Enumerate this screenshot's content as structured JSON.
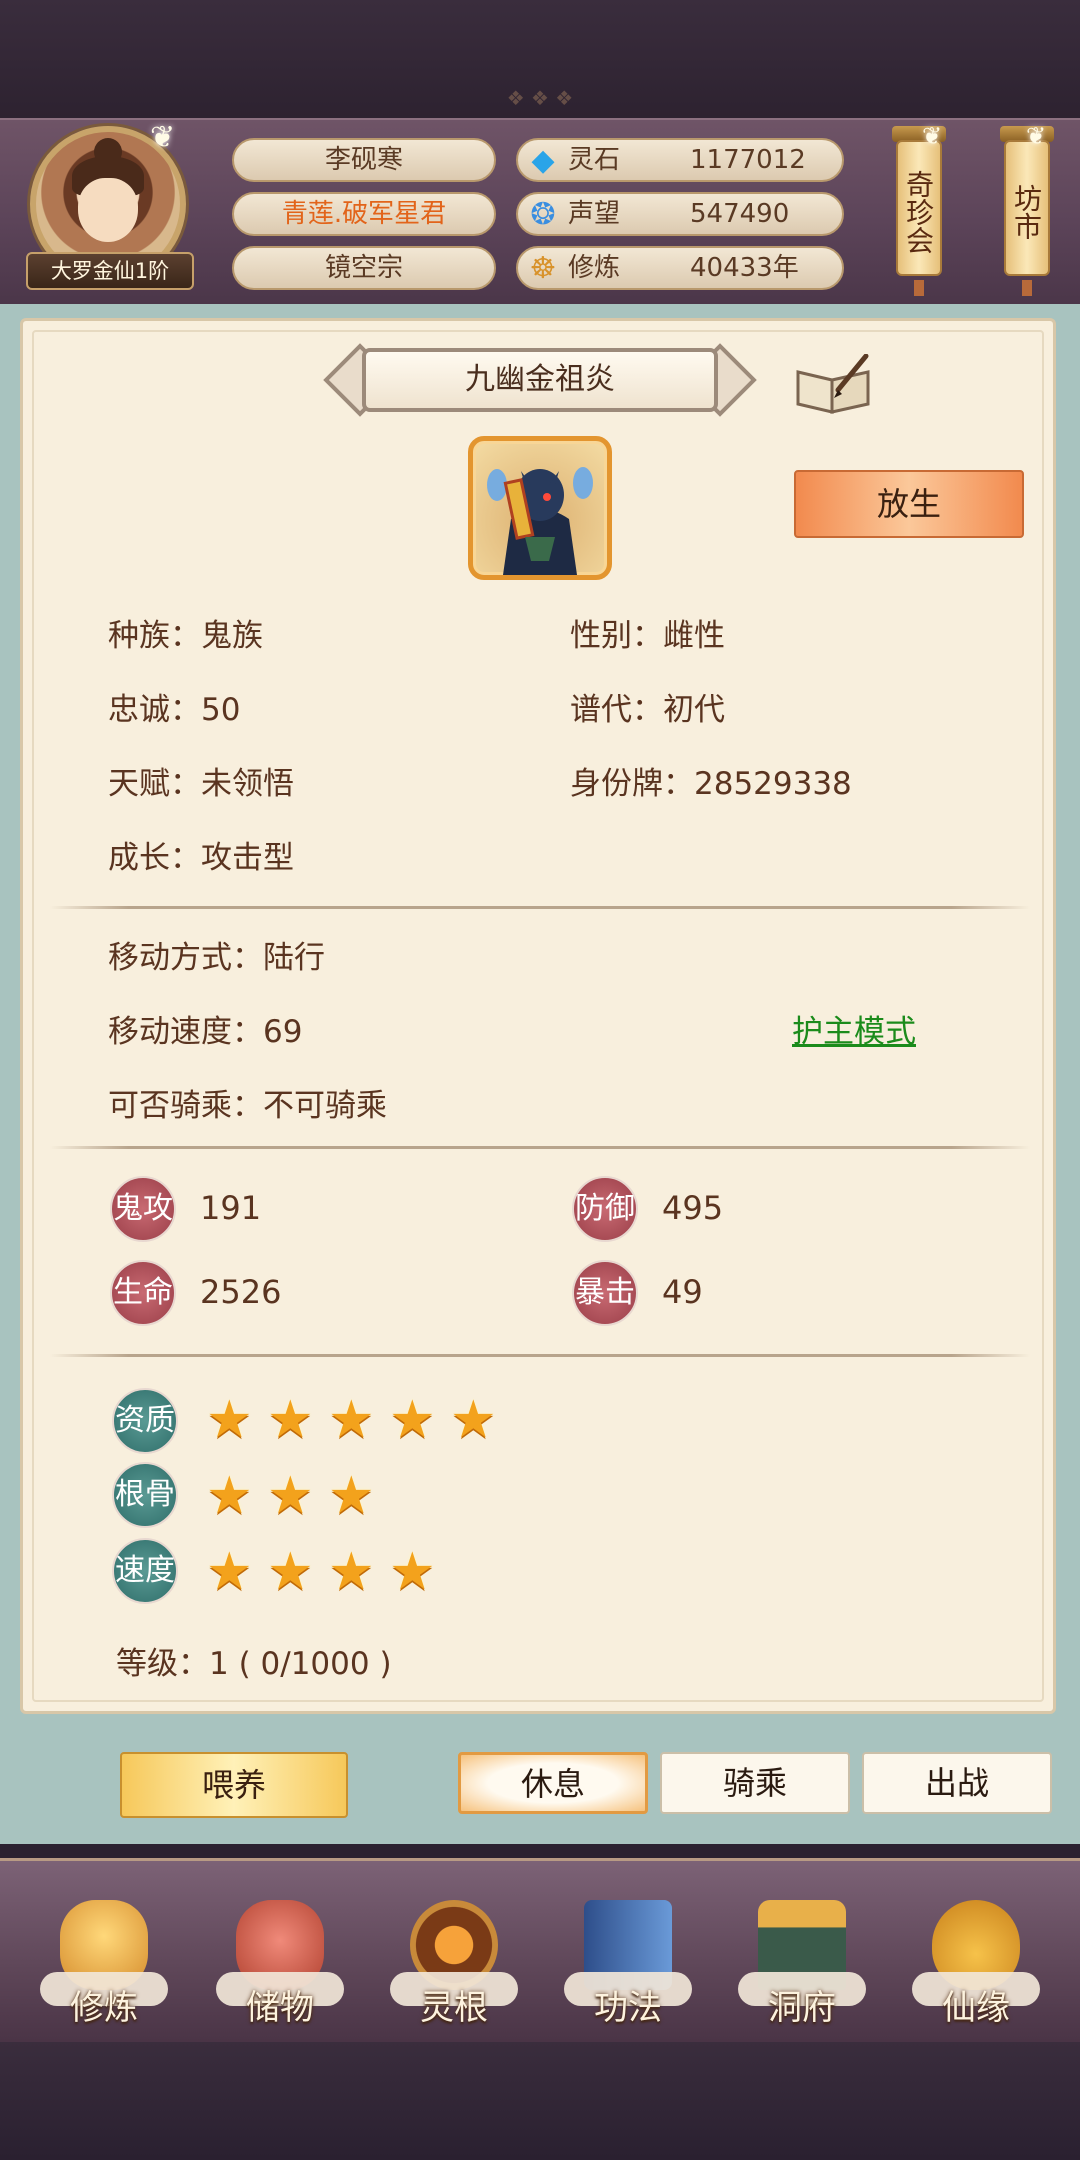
{
  "player": {
    "name": "李砚寒",
    "title": "青莲.破军星君",
    "sect": "镜空宗",
    "rank": "大罗金仙1阶"
  },
  "resources": [
    {
      "icon": "spirit-stone-icon",
      "label": "灵石",
      "value": "1177012"
    },
    {
      "icon": "reputation-icon",
      "label": "声望",
      "value": "547490"
    },
    {
      "icon": "cultivation-icon",
      "label": "修炼",
      "value": "40433年"
    }
  ],
  "lanterns": [
    {
      "label": "奇珍会"
    },
    {
      "label": "坊市"
    }
  ],
  "pet": {
    "name": "九幽金祖炎",
    "release_label": "放生",
    "attributes": {
      "race": "种族：鬼族",
      "gender": "性别：雌性",
      "loyalty": "忠诚：50",
      "generation": "谱代：初代",
      "talent": "天赋：未领悟",
      "id": "身份牌：28529338",
      "growth": "成长：攻击型"
    },
    "movement": {
      "mode": "移动方式：陆行",
      "speed": "移动速度：69",
      "rideable": "可否骑乘：不可骑乘",
      "guard_mode": "护主模式"
    },
    "stats": [
      {
        "label": "鬼攻",
        "value": "191"
      },
      {
        "label": "防御",
        "value": "495"
      },
      {
        "label": "生命",
        "value": "2526"
      },
      {
        "label": "暴击",
        "value": "49"
      }
    ],
    "ratings": [
      {
        "label": "资质",
        "stars": 5
      },
      {
        "label": "根骨",
        "stars": 3
      },
      {
        "label": "速度",
        "stars": 4
      }
    ],
    "level": "等级：1 ( 0/1000 )"
  },
  "actions": {
    "feed": "喂养",
    "rest": "休息",
    "ride": "骑乘",
    "battle": "出战"
  },
  "nav": [
    {
      "label": "修炼",
      "icon": "monk-icon"
    },
    {
      "label": "储物",
      "icon": "bag-icon"
    },
    {
      "label": "灵根",
      "icon": "spirit-root-icon"
    },
    {
      "label": "功法",
      "icon": "book-icon"
    },
    {
      "label": "洞府",
      "icon": "cave-house-icon"
    },
    {
      "label": "仙缘",
      "icon": "gourd-icon"
    }
  ],
  "colors": {
    "accent_orange": "#e2641a",
    "link_green": "#1b8b1b",
    "star": "#f3a21c"
  }
}
